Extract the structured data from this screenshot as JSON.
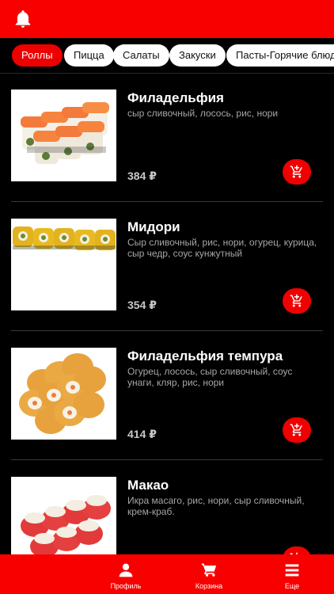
{
  "header": {
    "notification_icon": "bell-icon",
    "background": "#f90000"
  },
  "categories": [
    {
      "label": "Роллы",
      "active": true
    },
    {
      "label": "Пицца",
      "active": false
    },
    {
      "label": "Салаты",
      "active": false
    },
    {
      "label": "Закуски",
      "active": false
    },
    {
      "label": "Пасты-Горячие блюда",
      "active": false
    }
  ],
  "products": [
    {
      "name": "Филадельфия",
      "description": "сыр сливочный, лосось, рис, нори",
      "price": "384 ₽",
      "cart_icon": "add-to-cart-icon"
    },
    {
      "name": "Мидори",
      "description": "Сыр сливочный, рис, нори, огурец, курица, сыр чедр, соус кунжутный",
      "price": "354 ₽",
      "cart_icon": "add-to-cart-icon"
    },
    {
      "name": "Филадельфия темпура",
      "description": "Огурец, лосось, сыр сливочный, соус унаги, кляр, рис, нори",
      "price": "414 ₽",
      "cart_icon": "add-to-cart-icon"
    },
    {
      "name": "Макао",
      "description": "Икра масаго, рис, нори, сыр сливочный, крем-краб.",
      "price": "",
      "cart_icon": "add-to-cart-icon"
    }
  ],
  "bottom_nav": [
    {
      "label": "Профиль",
      "icon": "user-icon"
    },
    {
      "label": "Корзина",
      "icon": "cart-icon"
    },
    {
      "label": "Еще",
      "icon": "menu-icon"
    }
  ],
  "colors": {
    "accent": "#f90000",
    "background": "#000000",
    "chip_bg": "#ffffff",
    "muted_text": "#a6a6a6"
  }
}
